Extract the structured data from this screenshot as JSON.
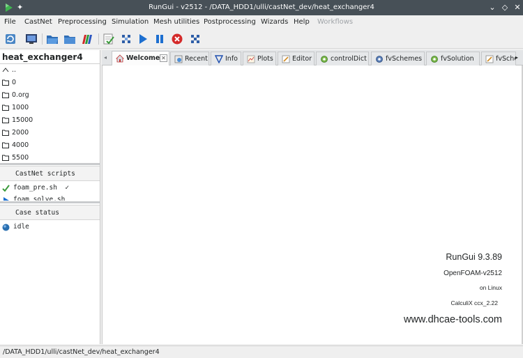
{
  "window": {
    "title": "RunGui - v2512 - /DATA_HDD1/ulli/castNet_dev/heat_exchanger4",
    "accent": "#3daee9",
    "titlebar_bg": "#475057"
  },
  "menubar": {
    "items": [
      "File",
      "CastNet",
      "Preprocessing",
      "Simulation",
      "Mesh utilities",
      "Postprocessing",
      "Wizards",
      "Help"
    ],
    "disabled_item": "Workflows"
  },
  "toolbar": {
    "icons": [
      "refresh-icon",
      "monitor-icon",
      "folder-open-icon",
      "folder-icon",
      "colorbar-icon",
      "edit-check-icon",
      "grid-select-icon",
      "play-icon",
      "pause-icon",
      "stop-icon",
      "grid-icon"
    ]
  },
  "case": {
    "name": "heat_exchanger4",
    "files": [
      "..",
      "0",
      "0.org",
      "1000",
      "15000",
      "2000",
      "4000",
      "5500"
    ]
  },
  "scripts": {
    "header": "CastNet scripts",
    "items": [
      {
        "label": "foam_pre.sh",
        "suffix": "✓"
      },
      {
        "label": "foam_solve.sh",
        "suffix": ""
      }
    ]
  },
  "case_status": {
    "header": "Case status",
    "value": "idle"
  },
  "tabs": [
    {
      "label": "Welcome",
      "icon": "home-icon",
      "active": true
    },
    {
      "label": "Recent",
      "icon": "recent-icon",
      "active": false
    },
    {
      "label": "Info",
      "icon": "info-icon",
      "active": false
    },
    {
      "label": "Plots",
      "icon": "plots-icon",
      "active": false
    },
    {
      "label": "Editor",
      "icon": "editor-icon",
      "active": false
    },
    {
      "label": "controlDict",
      "icon": "cog-icon",
      "active": false
    },
    {
      "label": "fvSchemes",
      "icon": "cog-icon",
      "active": false
    },
    {
      "label": "fvSolution",
      "icon": "cog-icon",
      "active": false
    },
    {
      "label": "fvSche",
      "icon": "editor-icon",
      "active": false
    }
  ],
  "welcome": {
    "rungui_version": "RunGui 9.3.89",
    "openfoam_version": "OpenFOAM-v2512",
    "platform": "on Linux",
    "ccx_version": "CalculiX ccx_2.22",
    "website": "www.dhcae-tools.com"
  },
  "statusbar": {
    "path": "/DATA_HDD1/ulli/castNet_dev/heat_exchanger4"
  }
}
